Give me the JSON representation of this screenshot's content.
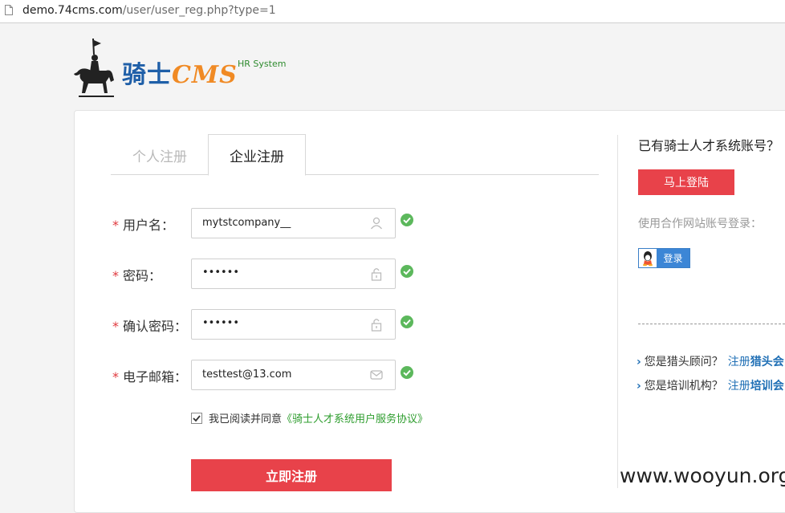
{
  "browser": {
    "url_host": "demo.74cms.com",
    "url_path": "/user/user_reg.php?type=1"
  },
  "logo": {
    "brand_text": "骑士",
    "brand_cms": "CMS",
    "tagline": "HR System"
  },
  "tabs": [
    {
      "label": "个人注册",
      "active": false
    },
    {
      "label": "企业注册",
      "active": true
    }
  ],
  "form": {
    "required_mark": "*",
    "username": {
      "label": "用户名：",
      "value": "mytstcompany__",
      "valid": true
    },
    "password": {
      "label": "密码：",
      "value": "••••••",
      "valid": true
    },
    "confirm_password": {
      "label": "确认密码：",
      "value": "••••••",
      "valid": true
    },
    "email": {
      "label": "电子邮箱：",
      "value": "testtest@13.com",
      "valid": true
    },
    "agree_text": "我已阅读并同意",
    "agree_link": "《骑士人才系统用户服务协议》",
    "agree_checked": true,
    "submit_label": "立即注册"
  },
  "sidebar": {
    "have_account": "已有骑士人才系统账号？",
    "login_label": "马上登陆",
    "partner_label": "使用合作网站账号登录：",
    "qq_login_label": "登录",
    "links": [
      {
        "chevron": "›",
        "question": "您是猎头顾问？",
        "register": "注册",
        "bold": "猎头会"
      },
      {
        "chevron": "›",
        "question": "您是培训机构？",
        "register": "注册",
        "bold": "培训会"
      }
    ]
  },
  "watermark": "www.wooyun.org",
  "colors": {
    "accent_red": "#e8424a",
    "link_blue": "#1f6fb5",
    "ok_green": "#5cb85c",
    "agree_green": "#2e9d2e"
  }
}
